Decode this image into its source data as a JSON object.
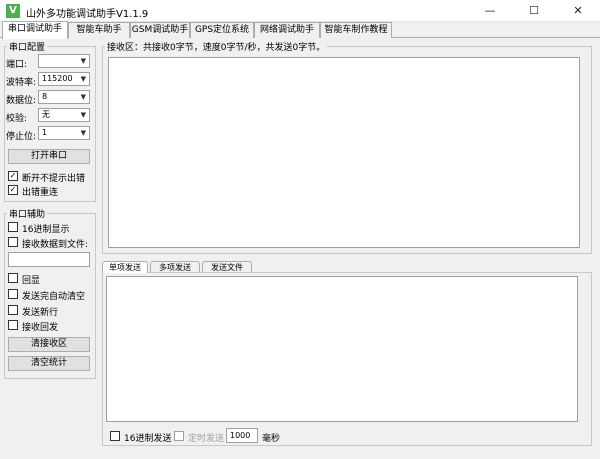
{
  "window": {
    "title": "山外多功能调试助手V1.1.9",
    "app_icon_glyph": "V",
    "minimize_glyph": "—",
    "maximize_glyph": "☐",
    "close_glyph": "✕"
  },
  "tabs": [
    "串口调试助手",
    "智能车助手",
    "GSM调试助手",
    "GPS定位系统",
    "网络调试助手",
    "智能车制作教程"
  ],
  "active_tab": "串口调试助手",
  "serial_config": {
    "title": "串口配置",
    "port_label": "端口:",
    "port_value": "",
    "baud_label": "波特率:",
    "baud_value": "115200",
    "databits_label": "数据位:",
    "databits_value": "8",
    "parity_label": "校验:",
    "parity_value": "无",
    "stopbits_label": "停止位:",
    "stopbits_value": "1",
    "open_button": "打开串口",
    "no_error_prompt_label": "断开不提示出错",
    "no_error_prompt_checked": true,
    "reconnect_label": "出错重连",
    "reconnect_checked": true
  },
  "serial_aux": {
    "title": "串口辅助",
    "hex_display_label": "16进制显示",
    "hex_display_checked": false,
    "save_to_file_label": "接收数据到文件:",
    "save_to_file_checked": false,
    "file_path": "",
    "echo_label": "回显",
    "echo_checked": false,
    "auto_clear_label": "发送完自动清空",
    "auto_clear_checked": false,
    "send_newline_label": "发送新行",
    "send_newline_checked": false,
    "recv_reply_label": "接收回发",
    "recv_reply_checked": false,
    "clear_recv_button": "清接收区",
    "clear_stats_button": "清空统计"
  },
  "receive": {
    "status": "接收区：共接收0字节，速度0字节/秒，共发送0字节。",
    "content": ""
  },
  "send": {
    "subtabs": [
      "单项发送",
      "多项发送",
      "发送文件"
    ],
    "active_subtab": "单项发送",
    "content": "",
    "hex_send_label": "16进制发送",
    "hex_send_checked": false,
    "timed_send_label": "定时发送",
    "timed_send_checked": false,
    "interval_value": "1000",
    "interval_unit": "毫秒"
  },
  "colors": {
    "window_bg": "#f0f0f0",
    "app_icon": "#4caf50"
  },
  "icons": {
    "check_glyph": "✓",
    "dropdown_glyph": "▼"
  }
}
